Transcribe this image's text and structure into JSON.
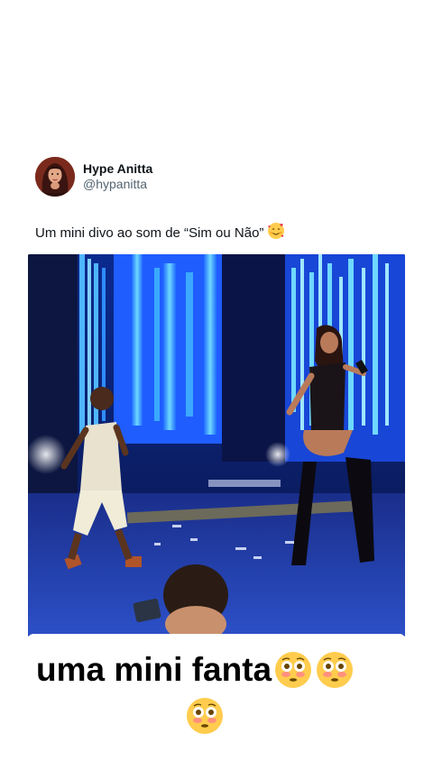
{
  "tweet": {
    "display_name": "Hype Anitta",
    "handle": "@hypanitta",
    "text": "Um mini divo ao som de “Sim ou Não”",
    "text_emoji": "smiling-face-with-hearts-icon"
  },
  "caption": {
    "text": "uma mini fanta",
    "emoji": "flushed-face-icon",
    "emoji_count": 3
  },
  "colors": {
    "text_primary": "#0f1419",
    "text_secondary": "#536471",
    "stage_blue": "#1f6cff",
    "caption_text": "#000000"
  }
}
